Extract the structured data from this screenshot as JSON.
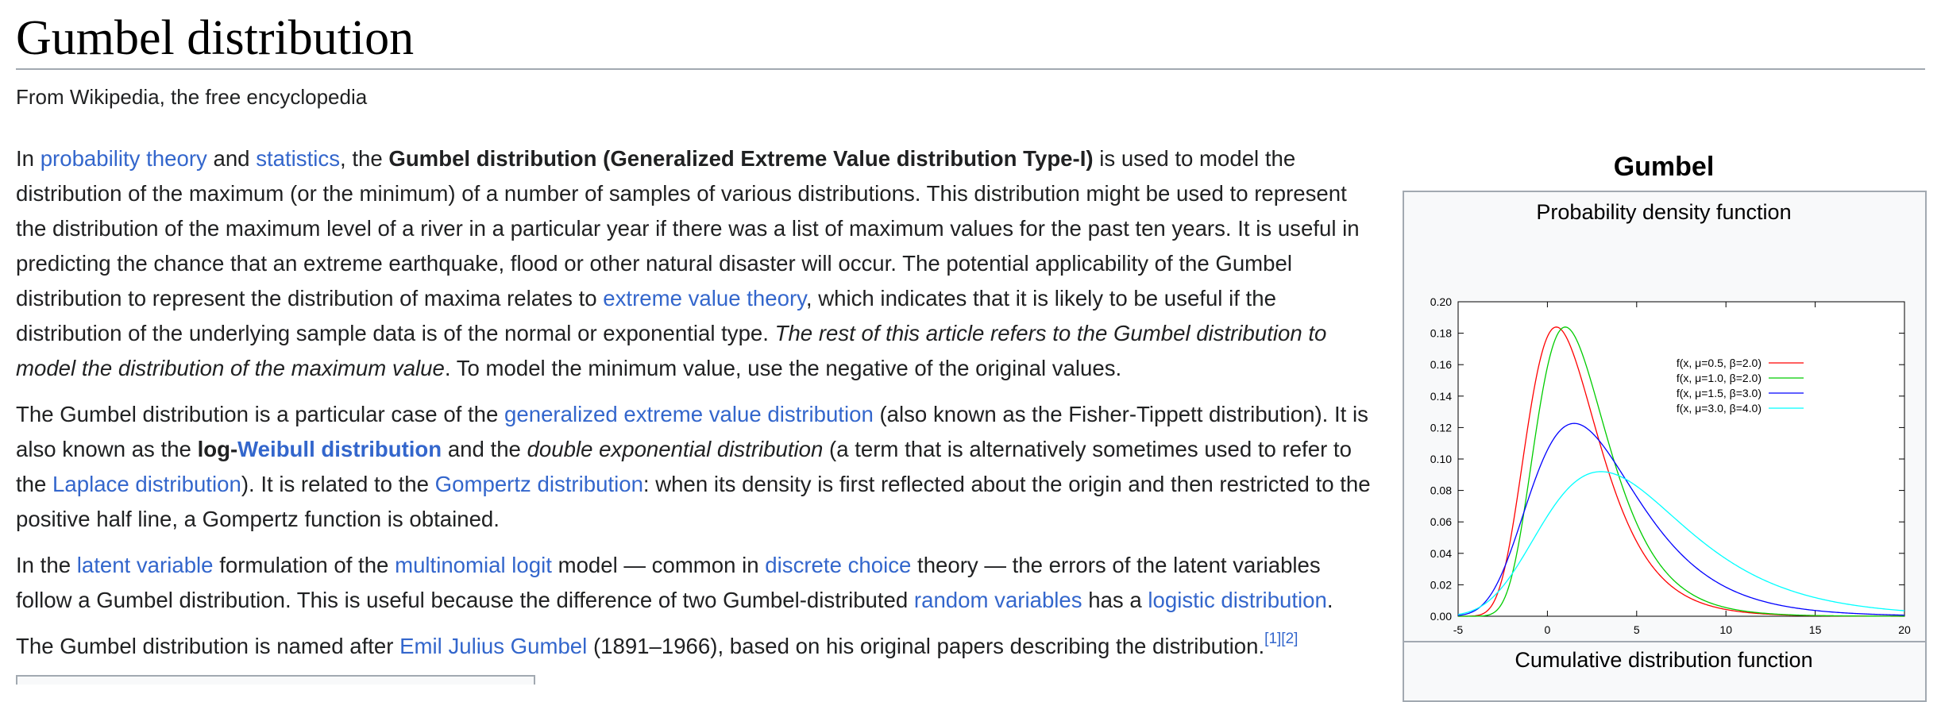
{
  "page": {
    "title": "Gumbel distribution",
    "tagline": "From Wikipedia, the free encyclopedia"
  },
  "article": {
    "p1": {
      "t1": "In ",
      "l1": "probability theory",
      "t2": " and ",
      "l2": "statistics",
      "t3": ", the ",
      "b1": "Gumbel distribution (Generalized Extreme Value distribution Type-I)",
      "t4": " is used to model the distribution of the maximum (or the minimum) of a number of samples of various distributions. This distribution might be used to represent the distribution of the maximum level of a river in a particular year if there was a list of maximum values for the past ten years. It is useful in predicting the chance that an extreme earthquake, flood or other natural disaster will occur. The potential applicability of the Gumbel distribution to represent the distribution of maxima relates to ",
      "l3": "extreme value theory",
      "t5": ", which indicates that it is likely to be useful if the distribution of the underlying sample data is of the normal or exponential type. ",
      "i1": "The rest of this article refers to the Gumbel distribution to model the distribution of the maximum value",
      "t6": ". To model the minimum value, use the negative of the original values."
    },
    "p2": {
      "t1": "The Gumbel distribution is a particular case of the ",
      "l1": "generalized extreme value distribution",
      "t2": " (also known as the Fisher-Tippett distribution). It is also known as the ",
      "b1": "log-",
      "bl1": "Weibull distribution",
      "t3": " and the ",
      "i1": "double exponential distribution",
      "t4": " (a term that is alternatively sometimes used to refer to the ",
      "l2": "Laplace distribution",
      "t5": "). It is related to the ",
      "l3": "Gompertz distribution",
      "t6": ": when its density is first reflected about the origin and then restricted to the positive half line, a Gompertz function is obtained."
    },
    "p3": {
      "t1": "In the ",
      "l1": "latent variable",
      "t2": " formulation of the ",
      "l2": "multinomial logit",
      "t3": " model — common in ",
      "l3": "discrete choice",
      "t4": " theory — the errors of the latent variables follow a Gumbel distribution. This is useful because the difference of two Gumbel-distributed ",
      "l4": "random variables",
      "t5": " has a ",
      "l5": "logistic distribution",
      "t6": "."
    },
    "p4": {
      "t1": "The Gumbel distribution is named after ",
      "l1": "Emil Julius Gumbel",
      "t2": " (1891–1966), based on his original papers describing the distribution.",
      "ref1": "[1]",
      "ref2": "[2]"
    }
  },
  "infobox": {
    "title": "Gumbel",
    "pdf_caption": "Probability density function",
    "cdf_caption": "Cumulative distribution function"
  },
  "colors": {
    "link": "#3366cc",
    "series_1": "#ff0000",
    "series_2": "#00cc00",
    "series_3": "#0000ff",
    "series_4": "#00ffff"
  },
  "chart_data": {
    "type": "line",
    "title": "Probability density function",
    "xlabel": "",
    "ylabel": "",
    "xlim": [
      -5,
      20
    ],
    "ylim": [
      0,
      0.2
    ],
    "xticks": [
      -5,
      0,
      5,
      10,
      15,
      20
    ],
    "yticks": [
      0.0,
      0.02,
      0.04,
      0.06,
      0.08,
      0.1,
      0.12,
      0.14,
      0.16,
      0.18,
      0.2
    ],
    "ytick_labels": [
      "0.00",
      "0.02",
      "0.04",
      "0.06",
      "0.08",
      "0.10",
      "0.12",
      "0.14",
      "0.16",
      "0.18",
      "0.20"
    ],
    "xtick_labels": [
      "-5",
      "0",
      "5",
      "10",
      "15",
      "20"
    ],
    "grid": false,
    "legend_position": "top-right",
    "series": [
      {
        "name": "f(x, μ=0.5, β=2.0)",
        "mu": 0.5,
        "beta": 2.0,
        "color": "#ff0000"
      },
      {
        "name": "f(x, μ=1.0, β=2.0)",
        "mu": 1.0,
        "beta": 2.0,
        "color": "#00cc00"
      },
      {
        "name": "f(x, μ=1.5, β=3.0)",
        "mu": 1.5,
        "beta": 3.0,
        "color": "#0000ff"
      },
      {
        "name": "f(x, μ=3.0, β=4.0)",
        "mu": 3.0,
        "beta": 4.0,
        "color": "#00ffff"
      }
    ]
  }
}
